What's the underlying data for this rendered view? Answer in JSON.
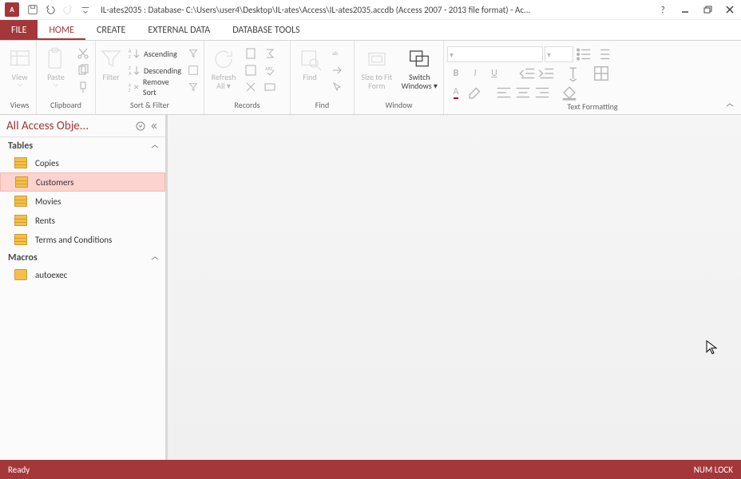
{
  "titlebar": {
    "app_char": "A",
    "title": "IL-ates2035 : Database- C:\\Users\\user4\\Desktop\\IL-ates\\Access\\IL-ates2035.accdb (Access 2007 - 2013 file format) - Ac..."
  },
  "tabs": {
    "file": "FILE",
    "home": "HOME",
    "create": "CREATE",
    "external": "EXTERNAL DATA",
    "dbtools": "DATABASE TOOLS"
  },
  "ribbon": {
    "views": {
      "view": "View",
      "label": "Views"
    },
    "clipboard": {
      "paste": "Paste",
      "label": "Clipboard"
    },
    "sortfilter": {
      "filter": "Filter",
      "asc": "Ascending",
      "desc": "Descending",
      "remove": "Remove Sort",
      "label": "Sort & Filter"
    },
    "records": {
      "refresh": "Refresh All",
      "label": "Records"
    },
    "find": {
      "find": "Find",
      "label": "Find"
    },
    "window": {
      "size": "Size to Fit Form",
      "switch": "Switch Windows",
      "label": "Window"
    },
    "textfmt": {
      "label": "Text Formatting"
    }
  },
  "nav": {
    "title": "All Access Obje...",
    "groups": {
      "tables": "Tables",
      "macros": "Macros"
    },
    "tables": [
      {
        "label": "Copies"
      },
      {
        "label": "Customers"
      },
      {
        "label": "Movies"
      },
      {
        "label": "Rents"
      },
      {
        "label": "Terms and Conditions"
      }
    ],
    "macros": [
      {
        "label": "autoexec"
      }
    ],
    "selected": "Customers"
  },
  "status": {
    "ready": "Ready",
    "numlock": "NUM LOCK"
  }
}
